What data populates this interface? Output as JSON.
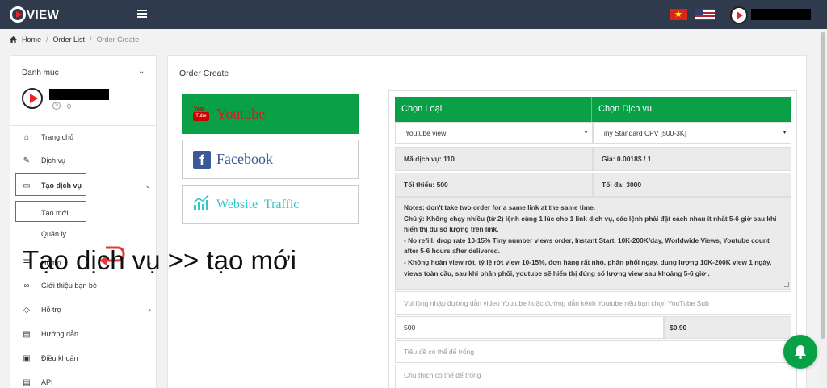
{
  "brand": {
    "logo_text": "VIEW"
  },
  "breadcrumb": {
    "items": [
      "Home",
      "Order List",
      "Order Create"
    ],
    "sep": "/"
  },
  "sidebar": {
    "header": "Danh mục",
    "balance": "0",
    "balance_symbol": "$",
    "items": [
      {
        "label": "Trang chủ",
        "icon": "home-icon"
      },
      {
        "label": "Dịch vụ",
        "icon": "tools-icon"
      },
      {
        "label": "Tạo dịch vụ",
        "icon": "store-icon"
      },
      {
        "label": "Hỗ trợ",
        "icon": "support-icon"
      },
      {
        "label": "Giới thiệu bạn bè",
        "icon": "link-icon"
      },
      {
        "label": "Hỗ trợ",
        "icon": "tag-icon"
      },
      {
        "label": "Hướng dẫn",
        "icon": "book-icon"
      },
      {
        "label": "Điều khoản",
        "icon": "clipboard-icon"
      },
      {
        "label": "API",
        "icon": "book-icon"
      }
    ],
    "subitems": [
      "Tạo mới",
      "Quản lý"
    ]
  },
  "overlay_caption": "Tạo dịch vụ >> tạo mới",
  "main": {
    "title": "Order Create",
    "platforms": [
      {
        "label": "Youtube",
        "icon": "youtube-icon",
        "yt_you": "You",
        "yt_tube": "Tube"
      },
      {
        "label": "Facebook",
        "icon": "facebook-icon",
        "fb_glyph": "f"
      },
      {
        "label": "Website  Traffic",
        "icon": "chart-icon"
      }
    ],
    "form": {
      "col_type": "Chọn Loại",
      "col_service": "Chọn Dịch vụ",
      "type_selected": "Youtube view",
      "service_selected": "Tiny Standard CPV [500-3K]",
      "service_code": "Mã dịch vụ: 110",
      "price_per": "Giá: 0.0018$ / 1",
      "min": "Tối thiểu: 500",
      "max": "Tối đa: 3000",
      "notes": [
        "Notes: don't take two order for a same link at the same time.",
        "Chú ý:  Không chạy nhiều (từ 2) lệnh cùng 1 lúc cho 1 link dịch vụ, các lệnh phải đặt cách nhau ít nhất 5-6 giờ sau khi hiển thị đủ số lượng trên link.",
        "- No refill,  drop rate 10-15% Tiny number views order, Instant Start,  10K-200K/day, Worldwide Views, Youtube count after 5-6 hours after delivered.",
        "- Không hoàn view rớt, tỷ lệ rớt view 10-15%, đơn hàng rất nhỏ, phân phối ngay, dung lượng 10K-200K view 1 ngày, views toàn cầu, sau khi phân phối, youtube sẽ hiển thị đúng số lượng view sau khoảng 5-6 giờ ."
      ],
      "link_placeholder": "Vui lòng nhập đường dẫn video Youtube hoặc đường dẫn kênh Youtube nếu bạn chọn YouTube Sub",
      "quantity": "500",
      "total": "$0.90",
      "title_placeholder": "Tiêu đề có thể để trống",
      "note_placeholder": "Chú thích có thể để trống"
    }
  },
  "colors": {
    "topbar": "#2f3b4c",
    "accent_green": "#0aa048",
    "highlight_red": "#e53935"
  }
}
